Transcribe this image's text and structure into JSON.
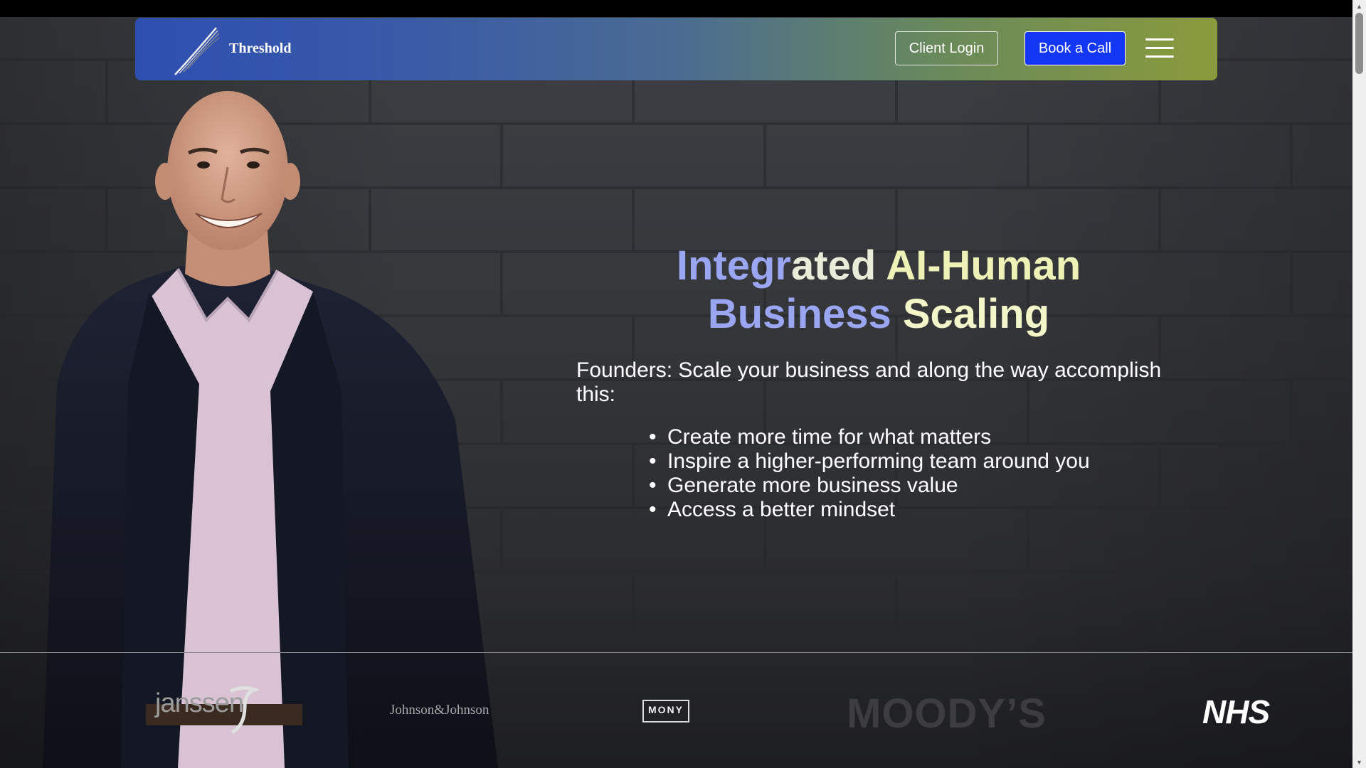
{
  "nav": {
    "brand": "Threshold",
    "client_login": "Client Login",
    "book_call": "Book a Call"
  },
  "hero": {
    "headline_words": [
      "Integr",
      "ated",
      " AI-",
      "Human",
      "Business",
      "Scaling"
    ],
    "subtitle": "Founders: Scale your business and along the way accomplish this:",
    "bullets": [
      "Create more time for what matters",
      "Inspire a higher-performing team around you",
      "Generate more business value",
      "Access a better mindset"
    ]
  },
  "clients": {
    "janssen": "janssen",
    "jnj": "Johnson&Johnson",
    "mony": "MONY",
    "moodys": "MOODY’S",
    "nhs": "NHS"
  },
  "colors": {
    "book_call_bg": "#1437f5",
    "headline_lavender": "#9aa6f2",
    "headline_yellow": "#eef2b6"
  }
}
